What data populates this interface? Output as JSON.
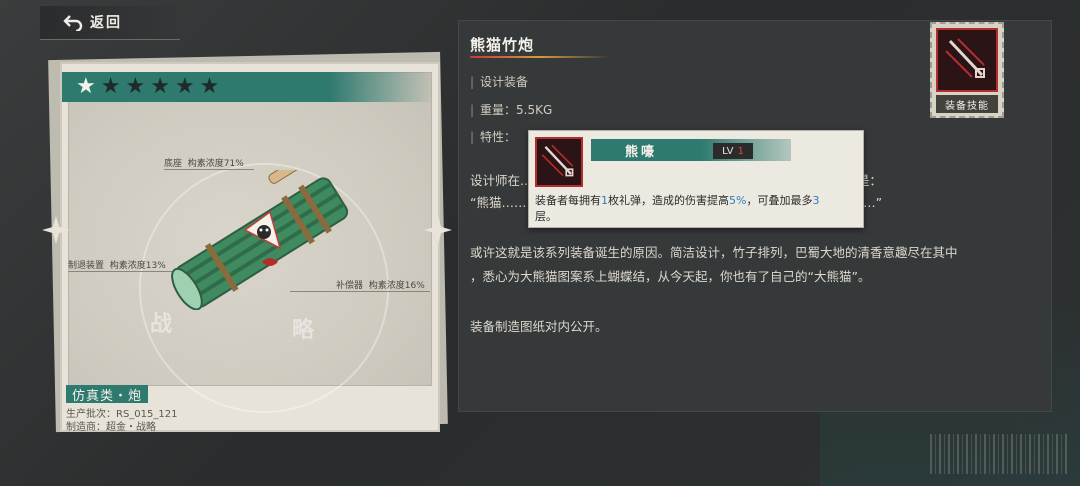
{
  "nav": {
    "back_label": "返回"
  },
  "card": {
    "stars_total": 6,
    "stars_lit": 1,
    "parts": [
      {
        "name": "底座",
        "detail": "构素浓度71%"
      },
      {
        "name": "制退装置",
        "detail": "构素浓度13%"
      },
      {
        "name": "补偿器",
        "detail": "构素浓度16%"
      }
    ],
    "watermark_chars": [
      "战",
      "略"
    ],
    "class_tag": "仿真类・炮",
    "batch": "生产批次：RS_015_121",
    "maker": "制造商：超金・战略"
  },
  "item": {
    "title": "熊猫竹炮",
    "attributes": [
      "设计装备",
      "重量：5.5KG",
      "特性："
    ],
    "desc_line1": "设计师在...区后，整日失魂落魄，嘴里总念叨着什么。仔细一听，似乎是：",
    "desc_line2": "“熊猫……                                                                     的大熊猫……”",
    "desc_para2_line1": "或许这就是该系列装备诞生的原因。简洁设计，竹子排列，巴蜀大地的清香意趣尽在其中",
    "desc_para2_line2": "，悉心为大熊猫图案系上蝴蝶结，从今天起，你也有了自己的“大熊猫”。",
    "desc_para3": "装备制造图纸对内公开。"
  },
  "skill_badge": {
    "label": "装备技能"
  },
  "tooltip": {
    "name": "熊嚎",
    "lv_label": "LV",
    "lv_value": "1",
    "text_a": "装备者每拥有",
    "num_a": "1",
    "text_b": "枚礼弹，造成的伤害提高",
    "num_b": "5%",
    "text_c": "，可叠加最多",
    "num_c": "3",
    "text_d": "层。"
  },
  "colors": {
    "teal": "#2f7a6f",
    "red": "#b52c2c",
    "highlight": "#2e7fc0"
  }
}
